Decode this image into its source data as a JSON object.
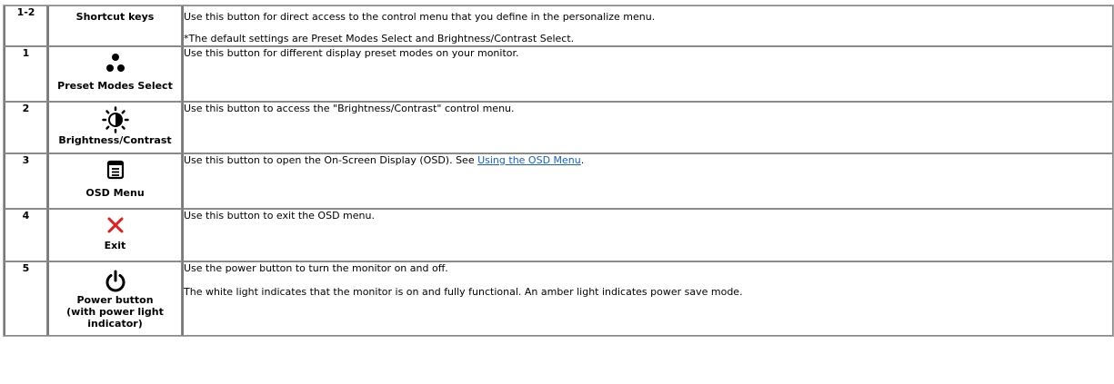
{
  "rows": [
    {
      "num": "1-2",
      "name_lines": [
        "Shortcut keys"
      ],
      "desc": [
        "Use this button for direct access to the control menu that you define in the personalize menu.",
        "*The default settings are Preset Modes Select and Brightness/Contrast Select."
      ],
      "icon": ""
    },
    {
      "num": "1",
      "name_lines": [
        "Preset Modes Select"
      ],
      "desc": [
        "Use this button for different display preset modes on your monitor."
      ],
      "icon": "three-dots-icon"
    },
    {
      "num": "2",
      "name_lines": [
        "Brightness/Contrast"
      ],
      "desc": [
        "Use this button to access the \"Brightness/Contrast\" control menu."
      ],
      "icon": "sun-brightness-icon"
    },
    {
      "num": "3",
      "name_lines": [
        "OSD Menu"
      ],
      "desc_prefix": "Use this button to open the On-Screen Display (OSD). See ",
      "desc_link": "Using the OSD Menu",
      "desc_suffix": ".",
      "icon": "menu-icon"
    },
    {
      "num": "4",
      "name_lines": [
        "Exit"
      ],
      "desc": [
        "Use this button to exit the OSD menu."
      ],
      "icon": "close-x-icon"
    },
    {
      "num": "5",
      "name_lines": [
        "Power button",
        "(with power light",
        "indicator)"
      ],
      "desc": [
        "Use the power button to turn the monitor on and off.",
        "The white light indicates that the monitor is on and fully functional. An amber light indicates power save mode."
      ],
      "icon": "power-icon"
    }
  ],
  "colors": {
    "link": "#1a5fc4",
    "exit_icon": "#e02020"
  }
}
